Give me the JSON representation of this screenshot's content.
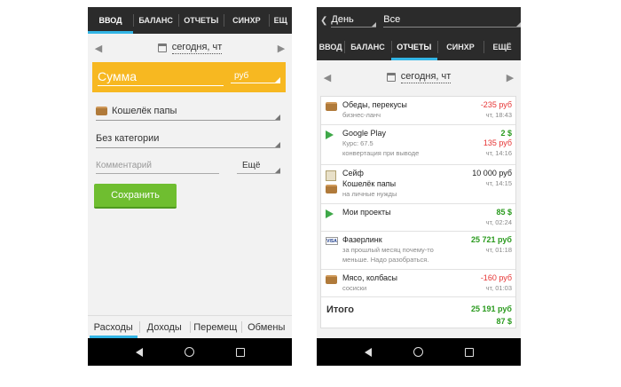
{
  "left": {
    "tabs": [
      "ВВОД",
      "БАЛАНС",
      "ОТЧЕТЫ",
      "СИНХР",
      "ЕЩ"
    ],
    "date": "сегодня, чт",
    "amount_placeholder": "Сумма",
    "currency": "руб",
    "wallet": "Кошелёк папы",
    "category": "Без категории",
    "comment_placeholder": "Комментарий",
    "more": "Ещё",
    "save": "Сохранить",
    "bottom_tabs": [
      "Расходы",
      "Доходы",
      "Перемещ",
      "Обмены"
    ]
  },
  "right": {
    "filter_period": "День",
    "filter_scope": "Все",
    "tabs": [
      "ВВОД",
      "БАЛАНС",
      "ОТЧЕТЫ",
      "СИНХР",
      "ЕЩЁ"
    ],
    "date": "сегодня, чт",
    "rows": [
      {
        "title": "Обеды, перекусы",
        "sub": "бизнес-ланч",
        "amount": "-235 руб",
        "time": "чт, 18:43"
      },
      {
        "title": "Google Play",
        "amount": "2 $",
        "sub": "Курс: 67.5",
        "amount2": "135 руб",
        "sub2": "конвертация при выводе",
        "time": "чт, 14:16"
      },
      {
        "title": "Сейф",
        "amount": "10 000 руб",
        "title2": "Кошелёк папы",
        "time": "чт, 14:15",
        "sub": "на личные нужды"
      },
      {
        "title": "Мои проекты",
        "amount": "85 $",
        "time": "чт, 02:24"
      },
      {
        "title": "Фазерлинк",
        "amount": "25 721 руб",
        "sub": "за прошлый месяц почему-то",
        "time": "чт, 01:18",
        "sub2": "меньше. Надо разобраться."
      },
      {
        "title": "Мясо, колбасы",
        "amount": "-160 руб",
        "sub": "сосиски",
        "time": "чт, 01:03"
      }
    ],
    "total_label": "Итого",
    "total_rub": "25 191 руб",
    "total_usd": "87 $"
  },
  "icons": {
    "visa_text": "VISA"
  },
  "colors": {
    "accent": "#33b5e5",
    "amount_field": "#f7b821",
    "save_button": "#6fbe30",
    "negative": "#e63434",
    "positive": "#2a9a1e"
  }
}
